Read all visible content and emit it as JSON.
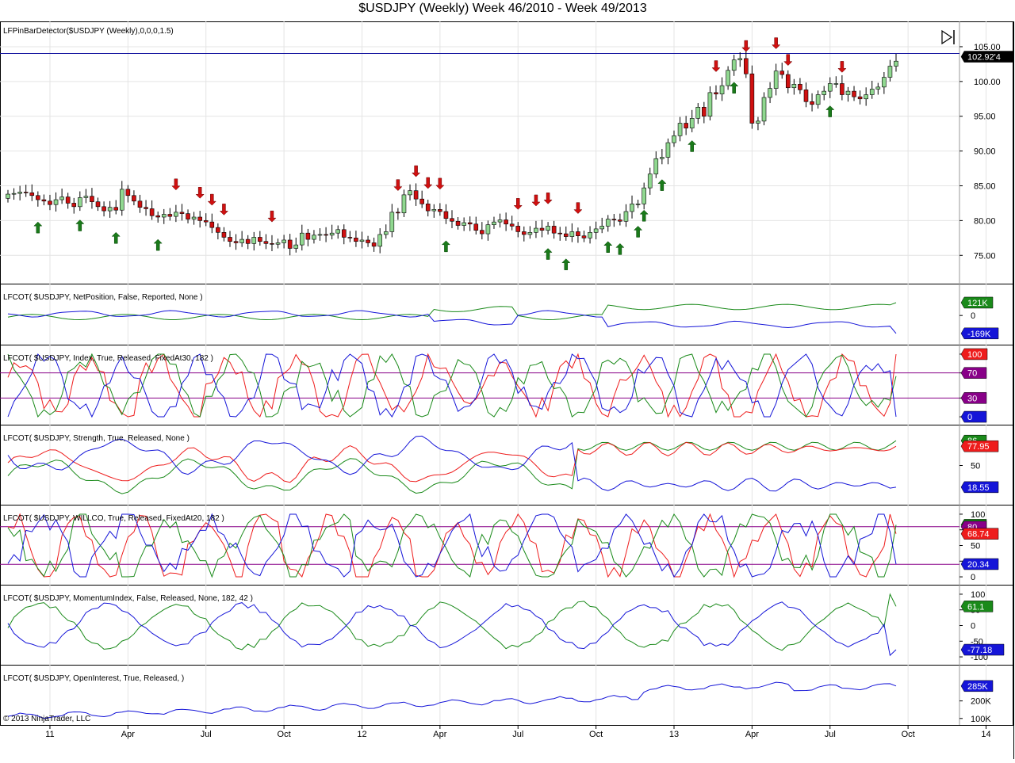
{
  "title": "$USDJPY (Weekly)  Week 46/2010 - Week 49/2013",
  "copyright": "© 2013 NinjaTrader, LLC",
  "colors": {
    "up": "#90d890",
    "down": "#d01010",
    "green": "#1a8a1a",
    "red": "#ee1c1c",
    "blue": "#1515d8",
    "purple": "#880088",
    "grid": "#e4e4e4"
  },
  "x_axis": {
    "labels": [
      {
        "text": "11",
        "i": 7
      },
      {
        "text": "Apr",
        "i": 20
      },
      {
        "text": "Jul",
        "i": 33
      },
      {
        "text": "Oct",
        "i": 46
      },
      {
        "text": "12",
        "i": 59
      },
      {
        "text": "Apr",
        "i": 72
      },
      {
        "text": "Jul",
        "i": 85
      },
      {
        "text": "Oct",
        "i": 98
      },
      {
        "text": "13",
        "i": 111
      },
      {
        "text": "Apr",
        "i": 124
      },
      {
        "text": "Jul",
        "i": 137
      },
      {
        "text": "Oct",
        "i": 150
      },
      {
        "text": "14",
        "i": 163
      }
    ]
  },
  "chart_data": [
    {
      "type": "candlestick",
      "name": "price",
      "label": "LFPinBarDetector($USDJPY (Weekly),0,0,0,1.5)",
      "yticks": [
        75,
        80,
        85,
        90,
        95,
        100,
        105
      ],
      "ylim": [
        71.5,
        107.5
      ],
      "last_price": 102.92,
      "last_label": "102.92'4",
      "close": [
        83.8,
        83.9,
        84.1,
        84.0,
        83.6,
        83.0,
        82.8,
        82.3,
        83.0,
        83.4,
        82.5,
        82.0,
        83.3,
        83.5,
        82.7,
        82.0,
        81.4,
        81.9,
        81.5,
        84.5,
        83.6,
        82.8,
        81.9,
        81.7,
        80.7,
        80.5,
        80.9,
        80.6,
        81.2,
        81.0,
        80.2,
        80.5,
        80.0,
        79.8,
        79.0,
        78.3,
        77.6,
        77.0,
        76.8,
        77.3,
        76.7,
        77.6,
        77.0,
        76.7,
        76.6,
        76.8,
        77.2,
        76.0,
        76.5,
        78.2,
        77.3,
        77.9,
        78.0,
        77.9,
        78.2,
        78.7,
        77.6,
        77.5,
        77.0,
        77.2,
        76.8,
        76.3,
        78.0,
        78.4,
        81.2,
        81.1,
        83.7,
        84.3,
        83.1,
        82.4,
        81.4,
        81.6,
        81.3,
        80.3,
        79.9,
        79.3,
        79.7,
        79.5,
        78.6,
        78.1,
        79.4,
        79.8,
        80.1,
        79.5,
        79.2,
        78.4,
        78.0,
        78.3,
        78.9,
        78.6,
        79.2,
        78.2,
        78.1,
        77.7,
        78.4,
        77.8,
        77.5,
        78.3,
        78.8,
        79.2,
        80.2,
        80.1,
        79.9,
        81.3,
        82.4,
        82.4,
        84.7,
        86.7,
        88.9,
        89.1,
        91.2,
        92.2,
        94.0,
        93.3,
        94.7,
        96.3,
        95.0,
        98.4,
        98.2,
        99.4,
        101.6,
        103.1,
        103.3,
        101.1,
        94.0,
        94.3,
        97.7,
        99.0,
        101.5,
        101.0,
        99.1,
        99.6,
        98.8,
        97.1,
        96.7,
        98.1,
        98.6,
        99.7,
        99.7,
        98.1,
        98.6,
        97.8,
        97.5,
        98.1,
        98.9,
        99.2,
        100.6,
        102.2,
        102.92
      ],
      "pin_down": [
        28,
        32,
        34,
        36,
        44,
        65,
        68,
        70,
        72,
        85,
        88,
        90,
        95,
        118,
        123,
        128,
        130,
        139,
        149
      ],
      "pin_up": [
        5,
        12,
        18,
        25,
        73,
        90,
        93,
        100,
        102,
        105,
        106,
        109,
        114,
        121,
        137,
        155
      ]
    },
    {
      "type": "line",
      "name": "netposition",
      "label": "LFCOT( $USDJPY, NetPosition, False, Reported, None )",
      "ylim": [
        -230,
        240
      ],
      "ticks": [
        {
          "v": 0,
          "t": "0"
        }
      ],
      "badges": [
        {
          "v": 121,
          "t": "121K",
          "color": "green"
        },
        {
          "v": -169,
          "t": "-169K",
          "color": "blue"
        }
      ],
      "series": [
        {
          "name": "green",
          "color": "green",
          "values": []
        },
        {
          "name": "blue",
          "color": "blue",
          "values": []
        }
      ]
    },
    {
      "type": "line",
      "name": "index",
      "label": "LFCOT( $USDJPY, Index, True, Released, FixedAt30, 182 )",
      "ylim": [
        -5,
        105
      ],
      "ticks": [
        {
          "v": 0,
          "t": ""
        },
        {
          "v": 30,
          "t": ""
        },
        {
          "v": 70,
          "t": ""
        },
        {
          "v": 100,
          "t": ""
        }
      ],
      "hlines": [
        30,
        70
      ],
      "badges": [
        {
          "v": 100,
          "t": "100",
          "color": "red"
        },
        {
          "v": 70,
          "t": "70",
          "color": "purple"
        },
        {
          "v": 30,
          "t": "30",
          "color": "purple"
        },
        {
          "v": 0,
          "t": "0",
          "color": "blue"
        }
      ],
      "series": [
        {
          "name": "red",
          "color": "red",
          "values": []
        },
        {
          "name": "green",
          "color": "green",
          "values": []
        },
        {
          "name": "blue",
          "color": "blue",
          "values": []
        }
      ]
    },
    {
      "type": "line",
      "name": "strength",
      "label": "LFCOT( $USDJPY, Strength, True, Released, None )",
      "ylim": [
        0,
        100
      ],
      "ticks": [
        {
          "v": 50,
          "t": "50"
        }
      ],
      "badges": [
        {
          "v": 86,
          "t": "86",
          "color": "green"
        },
        {
          "v": 77.95,
          "t": "77.95",
          "color": "red"
        },
        {
          "v": 18.55,
          "t": "18.55",
          "color": "blue"
        }
      ],
      "series": [
        {
          "name": "green",
          "color": "green",
          "values": []
        },
        {
          "name": "red",
          "color": "red",
          "values": []
        },
        {
          "name": "blue",
          "color": "blue",
          "values": []
        }
      ]
    },
    {
      "type": "line",
      "name": "willco",
      "label": "LFCOT( $USDJPY, WILLCO, True, Released, FixedAt20, 182 )",
      "ylim": [
        -5,
        105
      ],
      "ticks": [
        {
          "v": 0,
          "t": "0"
        },
        {
          "v": 25,
          "t": "25"
        },
        {
          "v": 50,
          "t": "50"
        },
        {
          "v": 75,
          "t": "75"
        },
        {
          "v": 100,
          "t": "100"
        }
      ],
      "hlines": [
        20,
        80
      ],
      "badges": [
        {
          "v": 83,
          "t": "83",
          "color": "green"
        },
        {
          "v": 80,
          "t": "80",
          "color": "purple"
        },
        {
          "v": 68.74,
          "t": "68.74",
          "color": "red"
        },
        {
          "v": 20.34,
          "t": "20.34",
          "color": "blue"
        }
      ],
      "series": [
        {
          "name": "red",
          "color": "red",
          "values": []
        },
        {
          "name": "green",
          "color": "green",
          "values": []
        },
        {
          "name": "blue",
          "color": "blue",
          "values": []
        }
      ]
    },
    {
      "type": "line",
      "name": "momentum",
      "label": "LFCOT( $USDJPY, MomentumIndex, False, Released, None, 182, 42 )",
      "ylim": [
        -110,
        110
      ],
      "ticks": [
        {
          "v": 100,
          "t": "100"
        },
        {
          "v": 50,
          "t": "50"
        },
        {
          "v": 0,
          "t": "0"
        },
        {
          "v": -50,
          "t": "-50"
        },
        {
          "v": -100,
          "t": "-100"
        }
      ],
      "badges": [
        {
          "v": 61.1,
          "t": "61.1",
          "color": "green"
        },
        {
          "v": -77.18,
          "t": "-77.18",
          "color": "blue"
        }
      ],
      "series": [
        {
          "name": "green",
          "color": "green",
          "values": []
        },
        {
          "name": "blue",
          "color": "blue",
          "values": []
        }
      ]
    },
    {
      "type": "line",
      "name": "openinterest",
      "label": "LFCOT( $USDJPY, OpenInterest, True, Released,  )",
      "ylim": [
        90,
        370
      ],
      "ticks": [
        {
          "v": 100,
          "t": "100K"
        },
        {
          "v": 200,
          "t": "200K"
        }
      ],
      "badges": [
        {
          "v": 285,
          "t": "285K",
          "color": "blue"
        }
      ],
      "series": [
        {
          "name": "blue",
          "color": "blue",
          "values": []
        }
      ]
    }
  ]
}
